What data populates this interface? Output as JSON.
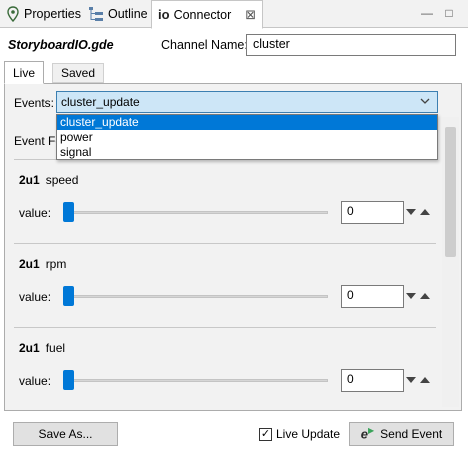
{
  "view_tabs": [
    {
      "label": "Properties",
      "icon": "pin-icon"
    },
    {
      "label": "Outline",
      "icon": "outline-icon"
    },
    {
      "label": "Connector",
      "icon": "io-icon",
      "icon_text": "io",
      "close": "⊠"
    }
  ],
  "window_controls": {
    "minimize": "—",
    "maximize": "□"
  },
  "header": {
    "file_name": "StoryboardIO.gde",
    "channel_label": "Channel Name:",
    "channel_value": "cluster"
  },
  "tabs": {
    "live": "Live",
    "saved": "Saved"
  },
  "events": {
    "label": "Events:",
    "selected": "cluster_update",
    "options": [
      "cluster_update",
      "power",
      "signal"
    ],
    "event_format_label_partial": "Event Fo"
  },
  "signals": [
    {
      "type": "2u1",
      "name": "speed",
      "value_label": "value:",
      "value": "0"
    },
    {
      "type": "2u1",
      "name": "rpm",
      "value_label": "value:",
      "value": "0"
    },
    {
      "type": "2u1",
      "name": "fuel",
      "value_label": "value:",
      "value": "0"
    }
  ],
  "footer": {
    "save_as": "Save As...",
    "live_update": "Live Update",
    "live_update_checked": true,
    "check_mark": "✓",
    "send_event": "Send Event",
    "send_icon_letter": "e"
  },
  "colors": {
    "accent": "#0078d7",
    "combo_bg": "#cde6f7"
  }
}
